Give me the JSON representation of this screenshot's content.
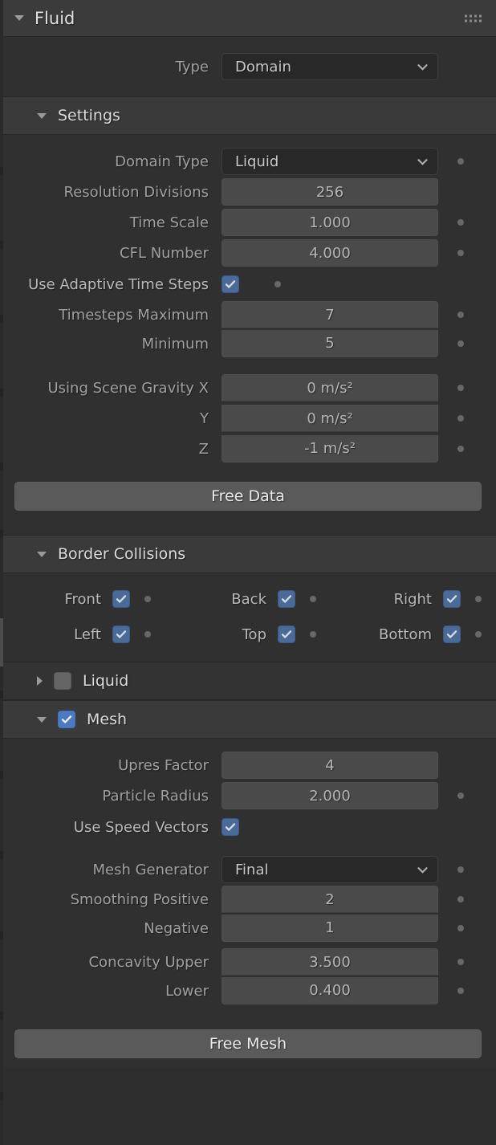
{
  "panel": {
    "title": "Fluid",
    "grip_icon": "drag-grip-icon"
  },
  "type_row": {
    "label": "Type",
    "value": "Domain"
  },
  "settings": {
    "header": "Settings",
    "rows": [
      {
        "label": "Domain Type",
        "value": "Liquid",
        "kind": "dropdown",
        "dot": true
      },
      {
        "label": "Resolution Divisions",
        "value": "256",
        "kind": "number",
        "dot": false
      },
      {
        "label": "Time Scale",
        "value": "1.000",
        "kind": "number",
        "dot": true
      },
      {
        "label": "CFL Number",
        "value": "4.000",
        "kind": "number",
        "dot": true
      }
    ],
    "adaptive": {
      "label": "Use Adaptive Time Steps",
      "checked": true,
      "dot": true
    },
    "timesteps": [
      {
        "label": "Timesteps Maximum",
        "value": "7",
        "dot": true
      },
      {
        "label": "Minimum",
        "value": "5",
        "dot": true
      }
    ],
    "gravity": [
      {
        "label": "Using Scene Gravity X",
        "value": "0 m/s²",
        "dot": true
      },
      {
        "label": "Y",
        "value": "0 m/s²",
        "dot": true
      },
      {
        "label": "Z",
        "value": "-1 m/s²",
        "dot": true
      }
    ],
    "free_data_button": "Free Data"
  },
  "border_collisions": {
    "header": "Border Collisions",
    "row1": [
      {
        "label": "Front",
        "checked": true
      },
      {
        "label": "Back",
        "checked": true
      },
      {
        "label": "Right",
        "checked": true
      }
    ],
    "row2": [
      {
        "label": "Left",
        "checked": true
      },
      {
        "label": "Top",
        "checked": true
      },
      {
        "label": "Bottom",
        "checked": true
      }
    ]
  },
  "liquid_section": {
    "header": "Liquid",
    "expanded": false,
    "checked": false
  },
  "mesh_section": {
    "header": "Mesh",
    "expanded": true,
    "checked": true,
    "rows": [
      {
        "label": "Upres Factor",
        "value": "4",
        "kind": "number",
        "dot": false
      },
      {
        "label": "Particle Radius",
        "value": "2.000",
        "kind": "number",
        "dot": true
      }
    ],
    "speed_vectors": {
      "label": "Use Speed Vectors",
      "checked": true,
      "dot": false
    },
    "generator": {
      "label": "Mesh Generator",
      "value": "Final",
      "dot": true
    },
    "smoothing": [
      {
        "label": "Smoothing Positive",
        "value": "2",
        "dot": true
      },
      {
        "label": "Negative",
        "value": "1",
        "dot": true
      }
    ],
    "concavity": [
      {
        "label": "Concavity Upper",
        "value": "3.500",
        "dot": true
      },
      {
        "label": "Lower",
        "value": "0.400",
        "dot": true
      }
    ],
    "free_mesh_button": "Free Mesh"
  },
  "colors": {
    "panel_bg": "#303030",
    "header_bg": "#3b3b3b",
    "field_bg": "#4a4a4a",
    "dropdown_bg": "#282828",
    "button_bg": "#5a5a5a",
    "checkbox_blue": "#4a6a9a",
    "checkbox_blue_bright": "#4a7ac0"
  }
}
